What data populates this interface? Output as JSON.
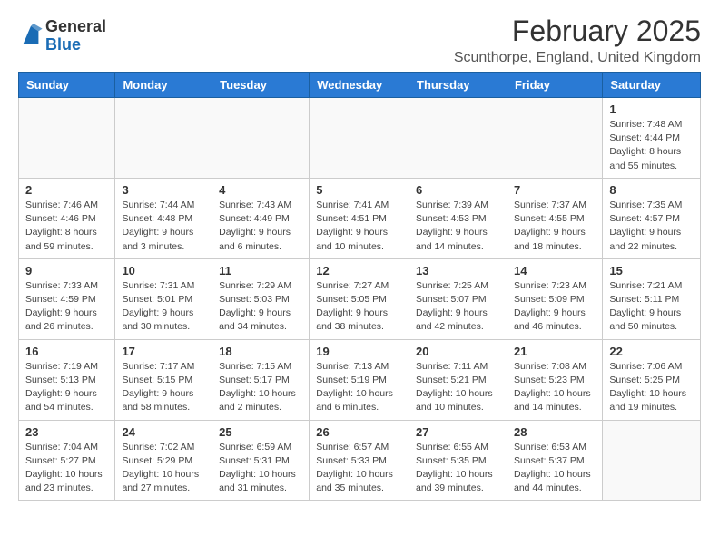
{
  "header": {
    "logo_general": "General",
    "logo_blue": "Blue",
    "month_title": "February 2025",
    "location": "Scunthorpe, England, United Kingdom"
  },
  "days_of_week": [
    "Sunday",
    "Monday",
    "Tuesday",
    "Wednesday",
    "Thursday",
    "Friday",
    "Saturday"
  ],
  "weeks": [
    [
      {
        "day": "",
        "info": ""
      },
      {
        "day": "",
        "info": ""
      },
      {
        "day": "",
        "info": ""
      },
      {
        "day": "",
        "info": ""
      },
      {
        "day": "",
        "info": ""
      },
      {
        "day": "",
        "info": ""
      },
      {
        "day": "1",
        "info": "Sunrise: 7:48 AM\nSunset: 4:44 PM\nDaylight: 8 hours and 55 minutes."
      }
    ],
    [
      {
        "day": "2",
        "info": "Sunrise: 7:46 AM\nSunset: 4:46 PM\nDaylight: 8 hours and 59 minutes."
      },
      {
        "day": "3",
        "info": "Sunrise: 7:44 AM\nSunset: 4:48 PM\nDaylight: 9 hours and 3 minutes."
      },
      {
        "day": "4",
        "info": "Sunrise: 7:43 AM\nSunset: 4:49 PM\nDaylight: 9 hours and 6 minutes."
      },
      {
        "day": "5",
        "info": "Sunrise: 7:41 AM\nSunset: 4:51 PM\nDaylight: 9 hours and 10 minutes."
      },
      {
        "day": "6",
        "info": "Sunrise: 7:39 AM\nSunset: 4:53 PM\nDaylight: 9 hours and 14 minutes."
      },
      {
        "day": "7",
        "info": "Sunrise: 7:37 AM\nSunset: 4:55 PM\nDaylight: 9 hours and 18 minutes."
      },
      {
        "day": "8",
        "info": "Sunrise: 7:35 AM\nSunset: 4:57 PM\nDaylight: 9 hours and 22 minutes."
      }
    ],
    [
      {
        "day": "9",
        "info": "Sunrise: 7:33 AM\nSunset: 4:59 PM\nDaylight: 9 hours and 26 minutes."
      },
      {
        "day": "10",
        "info": "Sunrise: 7:31 AM\nSunset: 5:01 PM\nDaylight: 9 hours and 30 minutes."
      },
      {
        "day": "11",
        "info": "Sunrise: 7:29 AM\nSunset: 5:03 PM\nDaylight: 9 hours and 34 minutes."
      },
      {
        "day": "12",
        "info": "Sunrise: 7:27 AM\nSunset: 5:05 PM\nDaylight: 9 hours and 38 minutes."
      },
      {
        "day": "13",
        "info": "Sunrise: 7:25 AM\nSunset: 5:07 PM\nDaylight: 9 hours and 42 minutes."
      },
      {
        "day": "14",
        "info": "Sunrise: 7:23 AM\nSunset: 5:09 PM\nDaylight: 9 hours and 46 minutes."
      },
      {
        "day": "15",
        "info": "Sunrise: 7:21 AM\nSunset: 5:11 PM\nDaylight: 9 hours and 50 minutes."
      }
    ],
    [
      {
        "day": "16",
        "info": "Sunrise: 7:19 AM\nSunset: 5:13 PM\nDaylight: 9 hours and 54 minutes."
      },
      {
        "day": "17",
        "info": "Sunrise: 7:17 AM\nSunset: 5:15 PM\nDaylight: 9 hours and 58 minutes."
      },
      {
        "day": "18",
        "info": "Sunrise: 7:15 AM\nSunset: 5:17 PM\nDaylight: 10 hours and 2 minutes."
      },
      {
        "day": "19",
        "info": "Sunrise: 7:13 AM\nSunset: 5:19 PM\nDaylight: 10 hours and 6 minutes."
      },
      {
        "day": "20",
        "info": "Sunrise: 7:11 AM\nSunset: 5:21 PM\nDaylight: 10 hours and 10 minutes."
      },
      {
        "day": "21",
        "info": "Sunrise: 7:08 AM\nSunset: 5:23 PM\nDaylight: 10 hours and 14 minutes."
      },
      {
        "day": "22",
        "info": "Sunrise: 7:06 AM\nSunset: 5:25 PM\nDaylight: 10 hours and 19 minutes."
      }
    ],
    [
      {
        "day": "23",
        "info": "Sunrise: 7:04 AM\nSunset: 5:27 PM\nDaylight: 10 hours and 23 minutes."
      },
      {
        "day": "24",
        "info": "Sunrise: 7:02 AM\nSunset: 5:29 PM\nDaylight: 10 hours and 27 minutes."
      },
      {
        "day": "25",
        "info": "Sunrise: 6:59 AM\nSunset: 5:31 PM\nDaylight: 10 hours and 31 minutes."
      },
      {
        "day": "26",
        "info": "Sunrise: 6:57 AM\nSunset: 5:33 PM\nDaylight: 10 hours and 35 minutes."
      },
      {
        "day": "27",
        "info": "Sunrise: 6:55 AM\nSunset: 5:35 PM\nDaylight: 10 hours and 39 minutes."
      },
      {
        "day": "28",
        "info": "Sunrise: 6:53 AM\nSunset: 5:37 PM\nDaylight: 10 hours and 44 minutes."
      },
      {
        "day": "",
        "info": ""
      }
    ]
  ]
}
